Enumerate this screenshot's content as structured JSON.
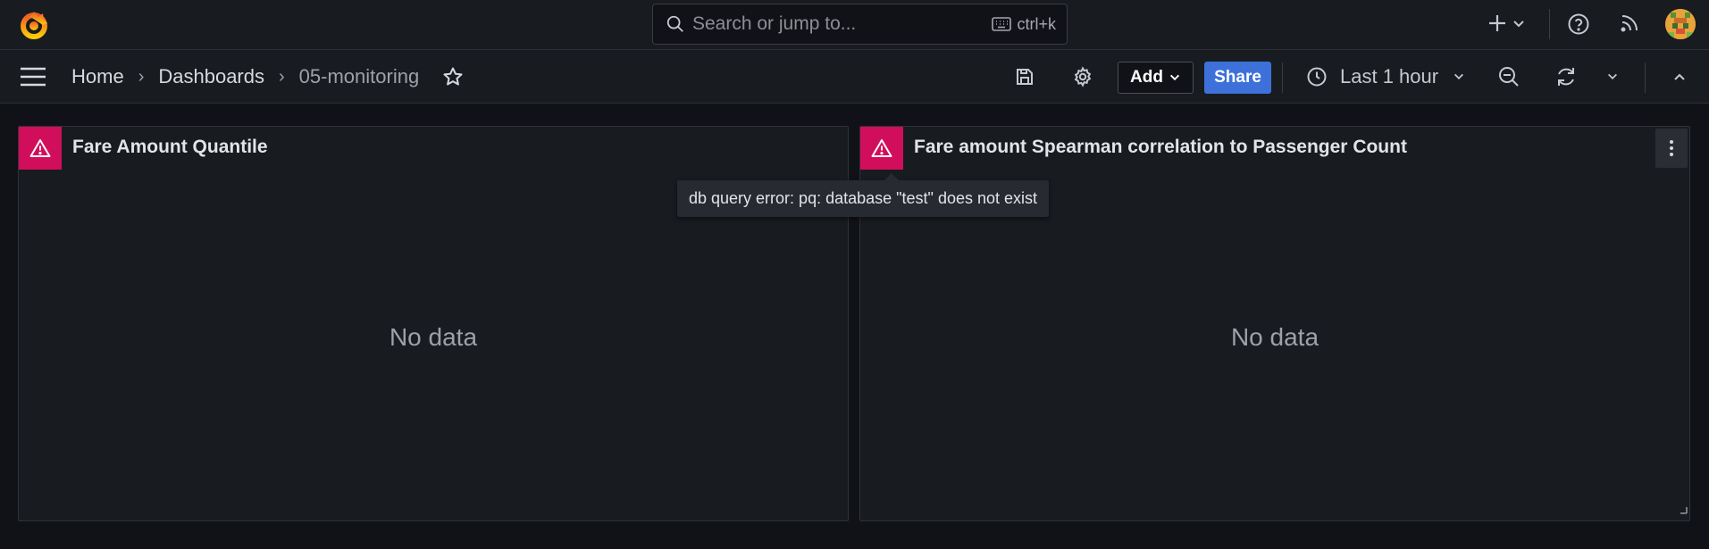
{
  "topbar": {
    "search_placeholder": "Search or jump to...",
    "search_shortcut": "ctrl+k"
  },
  "navbar": {
    "breadcrumb": [
      "Home",
      "Dashboards",
      "05-monitoring"
    ],
    "add_label": "Add",
    "share_label": "Share",
    "time_range": "Last 1 hour"
  },
  "panels": [
    {
      "title": "Fare Amount Quantile",
      "empty_text": "No data"
    },
    {
      "title": "Fare amount Spearman correlation to Passenger Count",
      "empty_text": "No data"
    }
  ],
  "tooltip": {
    "text": "db query error: pq: database \"test\" does not exist"
  },
  "colors": {
    "error": "#d10e5c",
    "primary": "#3d71d9",
    "logo": "#f46800"
  }
}
